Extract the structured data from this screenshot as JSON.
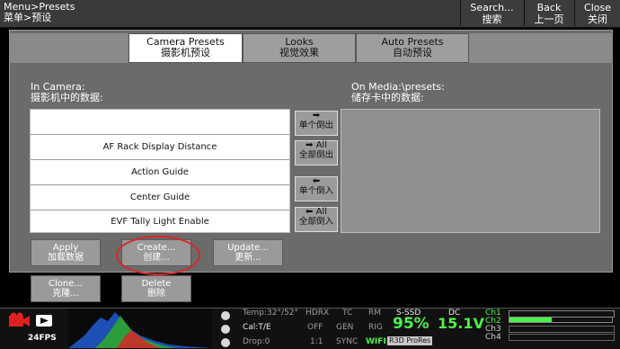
{
  "topbar": {
    "breadcrumb_en": "Menu>Presets",
    "breadcrumb_cn": "菜单>预设",
    "buttons": [
      {
        "en": "Search...",
        "cn": "搜索"
      },
      {
        "en": "Back",
        "cn": "上一页"
      },
      {
        "en": "Close",
        "cn": "关闭"
      }
    ]
  },
  "tabs": [
    {
      "en": "Camera Presets",
      "cn": "摄影机预设",
      "active": true
    },
    {
      "en": "Looks",
      "cn": "视觉效果",
      "active": false
    },
    {
      "en": "Auto Presets",
      "cn": "自动预设",
      "active": false
    }
  ],
  "left_panel": {
    "header_en": "In Camera:",
    "header_cn": "摄影机中的数据:",
    "items": [
      "",
      "AF Rack Display Distance",
      "Action Guide",
      "Center Guide",
      "EVF Tally Light Enable"
    ]
  },
  "right_panel": {
    "header_en": "On Media:\\presets:",
    "header_cn": "储存卡中的数据:"
  },
  "transfer_buttons": [
    {
      "icon": "➡",
      "label_en": "",
      "label_cn": "单个倒出"
    },
    {
      "icon": "➡",
      "label_en": "All",
      "label_cn": "全部倒出"
    },
    {
      "icon": "⬅",
      "label_en": "",
      "label_cn": "单个倒入"
    },
    {
      "icon": "⬅",
      "label_en": "All",
      "label_cn": "全部倒入"
    }
  ],
  "actions": {
    "apply": {
      "en": "Apply",
      "cn": "加载数据"
    },
    "create": {
      "en": "Create...",
      "cn": "创建..."
    },
    "update": {
      "en": "Update...",
      "cn": "更新..."
    },
    "clone": {
      "en": "Clone...",
      "cn": "克隆..."
    },
    "delete": {
      "en": "Delete",
      "cn": "删除"
    }
  },
  "status": {
    "fps": "24FPS",
    "temp": "Temp:32°/52°",
    "cal": "Cal:T/E",
    "drop": "Drop:0",
    "hdrx": "HDRX",
    "off": "OFF",
    "ratio": "1:1",
    "tc": "TC",
    "gen": "GEN",
    "sync": "SYNC",
    "rm": "RM",
    "rig": "RIG",
    "wifi": "WIFI",
    "media": "S-SSD",
    "media_pct": "95%",
    "codec": "R3D ProRes",
    "dc": "DC",
    "voltage": "15.1V",
    "channels": [
      "Ch1",
      "Ch2",
      "Ch3",
      "Ch4"
    ]
  },
  "colors": {
    "accent_red": "#d8262c",
    "status_green": "#4cf24a"
  }
}
